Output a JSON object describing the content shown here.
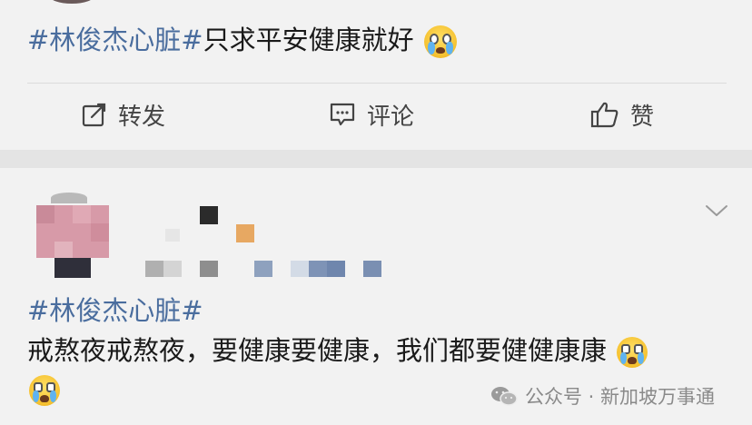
{
  "post_top": {
    "hashtag": "#林俊杰心脏#",
    "text": "只求平安健康就好"
  },
  "actions": {
    "repost_label": "转发",
    "comment_label": "评论",
    "like_label": "赞"
  },
  "post_bottom": {
    "hashtag": "#林俊杰心脏#",
    "text": "戒熬夜戒熬夜，要健康要健康，我们都要健健康康"
  },
  "watermark": {
    "text": "公众号 · 新加坡万事通"
  },
  "icons": {
    "repost": "edit-share-icon",
    "comment": "comment-icon",
    "like": "thumbs-up-icon",
    "emoji": "crying-face-emoji",
    "more": "chevron-down-icon",
    "wechat": "wechat-logo-icon"
  },
  "colors": {
    "hashtag": "#4a6d9e",
    "background": "#f2f2f2",
    "separator": "#e4e4e4"
  }
}
